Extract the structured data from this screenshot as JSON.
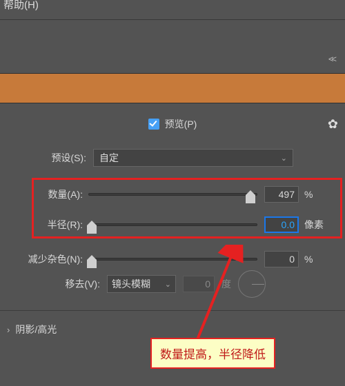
{
  "menu_fragment": "帮助(H)",
  "preview_label": "预览(P)",
  "preset": {
    "label": "预设(S):",
    "value": "自定"
  },
  "amount": {
    "label": "数量(A):",
    "value": "497",
    "unit": "%"
  },
  "radius": {
    "label": "半径(R):",
    "value": "0.0",
    "unit": "像素"
  },
  "noise": {
    "label": "减少杂色(N):",
    "value": "0",
    "unit": "%"
  },
  "remove": {
    "label": "移去(V):",
    "value": "镜头模糊",
    "angle_value": "0",
    "angle_unit": "度"
  },
  "section_shadow": "阴影/高光",
  "callout": "数量提高，半径降低"
}
